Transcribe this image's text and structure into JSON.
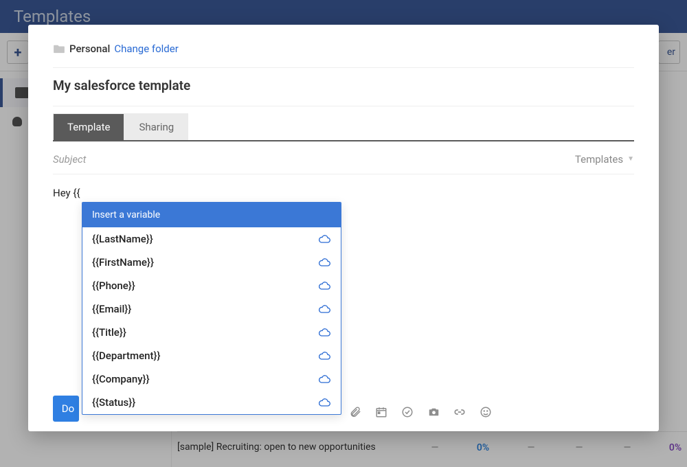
{
  "background": {
    "header_title": "Templates",
    "sample_row": {
      "name": "[sample] Recruiting: open to new opportunities",
      "cells": [
        "—",
        "0%",
        "—",
        "—",
        "—",
        "0%"
      ]
    },
    "right_button_fragment": "er"
  },
  "modal": {
    "breadcrumb": {
      "folder": "Personal",
      "change": "Change folder"
    },
    "title": "My salesforce template",
    "tabs": {
      "template": "Template",
      "sharing": "Sharing"
    },
    "subject_placeholder": "Subject",
    "templates_dropdown": "Templates",
    "editor_text": "Hey {{",
    "primary_button": "Do",
    "variable_popover": {
      "header": "Insert a variable",
      "items": [
        "{{LastName}}",
        "{{FirstName}}",
        "{{Phone}}",
        "{{Email}}",
        "{{Title}}",
        "{{Department}}",
        "{{Company}}",
        "{{Status}}"
      ]
    }
  }
}
